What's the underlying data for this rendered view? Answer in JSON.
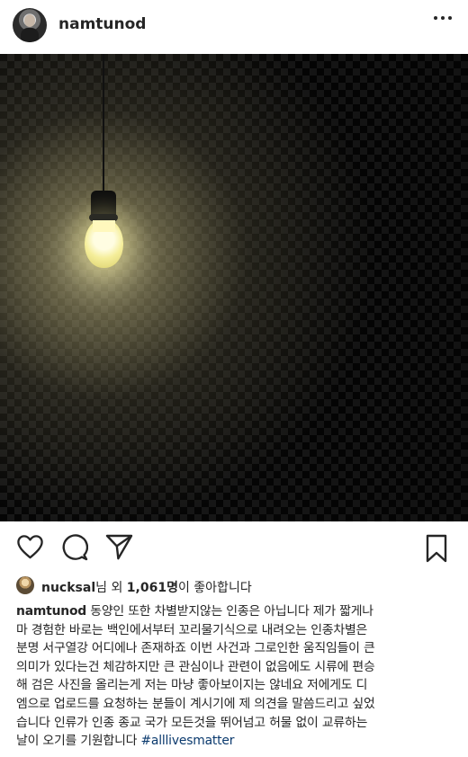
{
  "post": {
    "username": "namtunod",
    "image_icon": "light-bulb-icon"
  },
  "likes": {
    "liker_name": "nucksal",
    "suffix_before_count": "님 외 ",
    "count": "1,061명",
    "suffix_after_count": "이 좋아합니다"
  },
  "caption": {
    "username": "namtunod",
    "lines": [
      "동양인 또한 차별받지않는 인종은 아닙니다 제가 짧게나",
      "마 경험한 바로는 백인에서부터 꼬리물기식으로 내려오는 인종차별은",
      "분명 서구열강 어디에나 존재하죠 이번 사건과 그로인한 움직임들이 큰",
      "의미가 있다는건 체감하지만 큰 관심이나 관련이 없음에도 시류에 편승",
      "해 검은 사진을 올리는게 저는 마냥 좋아보이지는 않네요 저에게도 디",
      "엠으로 업로드를 요청하는 분들이 계시기에 제 의견을 말씀드리고 싶었",
      "습니다 인류가 인종 종교 국가 모든것을 뛰어넘고 허물 없이 교류하는",
      "날이 오기를 기원합니다"
    ],
    "hashtag": "#alllivesmatter"
  },
  "icons": {
    "more": "more-options-icon",
    "heart": "heart-icon",
    "comment": "comment-icon",
    "share": "share-icon",
    "bookmark": "bookmark-icon"
  }
}
